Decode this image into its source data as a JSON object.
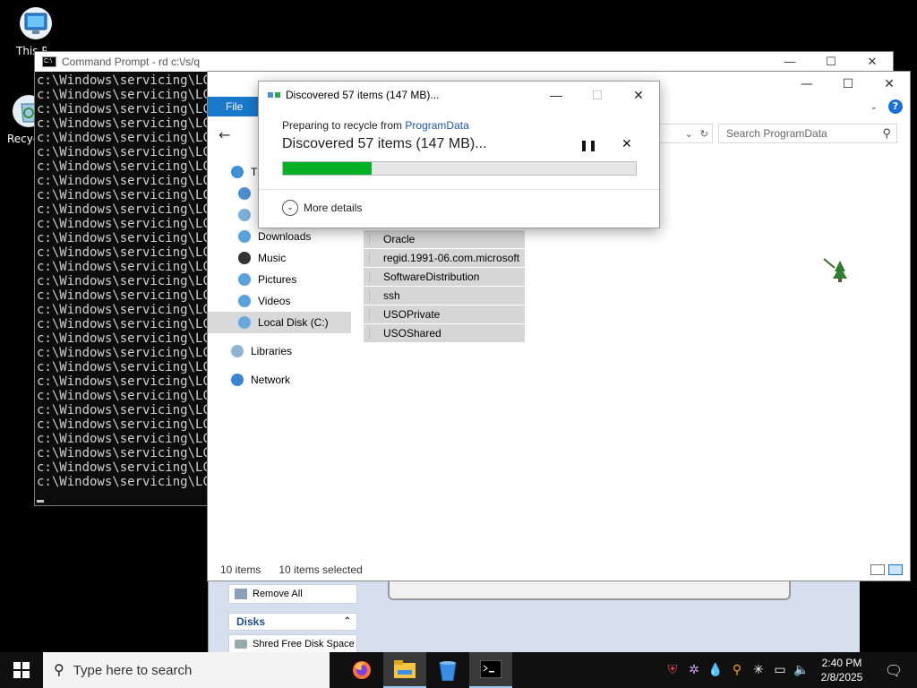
{
  "desktop": {
    "icons": [
      {
        "label": "This PC"
      },
      {
        "label": "Recycle Bin"
      }
    ]
  },
  "cmd": {
    "title": "Command Prompt - rd  c:\\/s/q",
    "line_text": "c:\\Windows\\servicing\\LCU",
    "lines": 29,
    "controls": [
      "—",
      "☐",
      "✕"
    ]
  },
  "explorer": {
    "ribbon": {
      "file_tab": "File",
      "help": "?"
    },
    "search_placeholder": "Search ProgramData",
    "nav": [
      {
        "label": "Th",
        "color": "#3d8fd6"
      },
      {
        "label": "D",
        "color": "#4b8fd0"
      },
      {
        "label": "D",
        "color": "#7bb0d9"
      },
      {
        "label": "Downloads",
        "color": "#5aa2de"
      },
      {
        "label": "Music",
        "color": "#333333"
      },
      {
        "label": "Pictures",
        "color": "#5aa2de"
      },
      {
        "label": "Videos",
        "color": "#5aa2de"
      },
      {
        "label": "Local Disk (C:)",
        "color": "#69a8d8",
        "selected": true
      },
      {
        "label": "Libraries",
        "color": "#8fb4d2"
      },
      {
        "label": "Network",
        "color": "#3a85d1"
      }
    ],
    "files": [
      "Oracle",
      "regid.1991-06.com.microsoft",
      "SoftwareDistribution",
      "ssh",
      "USOPrivate",
      "USOShared"
    ],
    "status": {
      "count": "10 items",
      "selected": "10 items selected"
    }
  },
  "utility": {
    "remove_all": "Remove All",
    "disks_header": "Disks",
    "shred_free": "Shred Free Disk Space"
  },
  "dialog": {
    "title": "Discovered 57 items (147 MB)...",
    "preparing_prefix": "Preparing to recycle from ",
    "source_link": "ProgramData",
    "heading": "Discovered 57 items (147 MB)...",
    "progress_percent": 25,
    "more_details": "More details",
    "accent": "#06b025"
  },
  "taskbar": {
    "search_placeholder": "Type here to search",
    "apps": [
      "firefox-icon",
      "file-explorer-icon",
      "recycle-icon",
      "terminal-icon"
    ],
    "clock_time": "2:40 PM",
    "clock_date": "2/8/2025"
  }
}
